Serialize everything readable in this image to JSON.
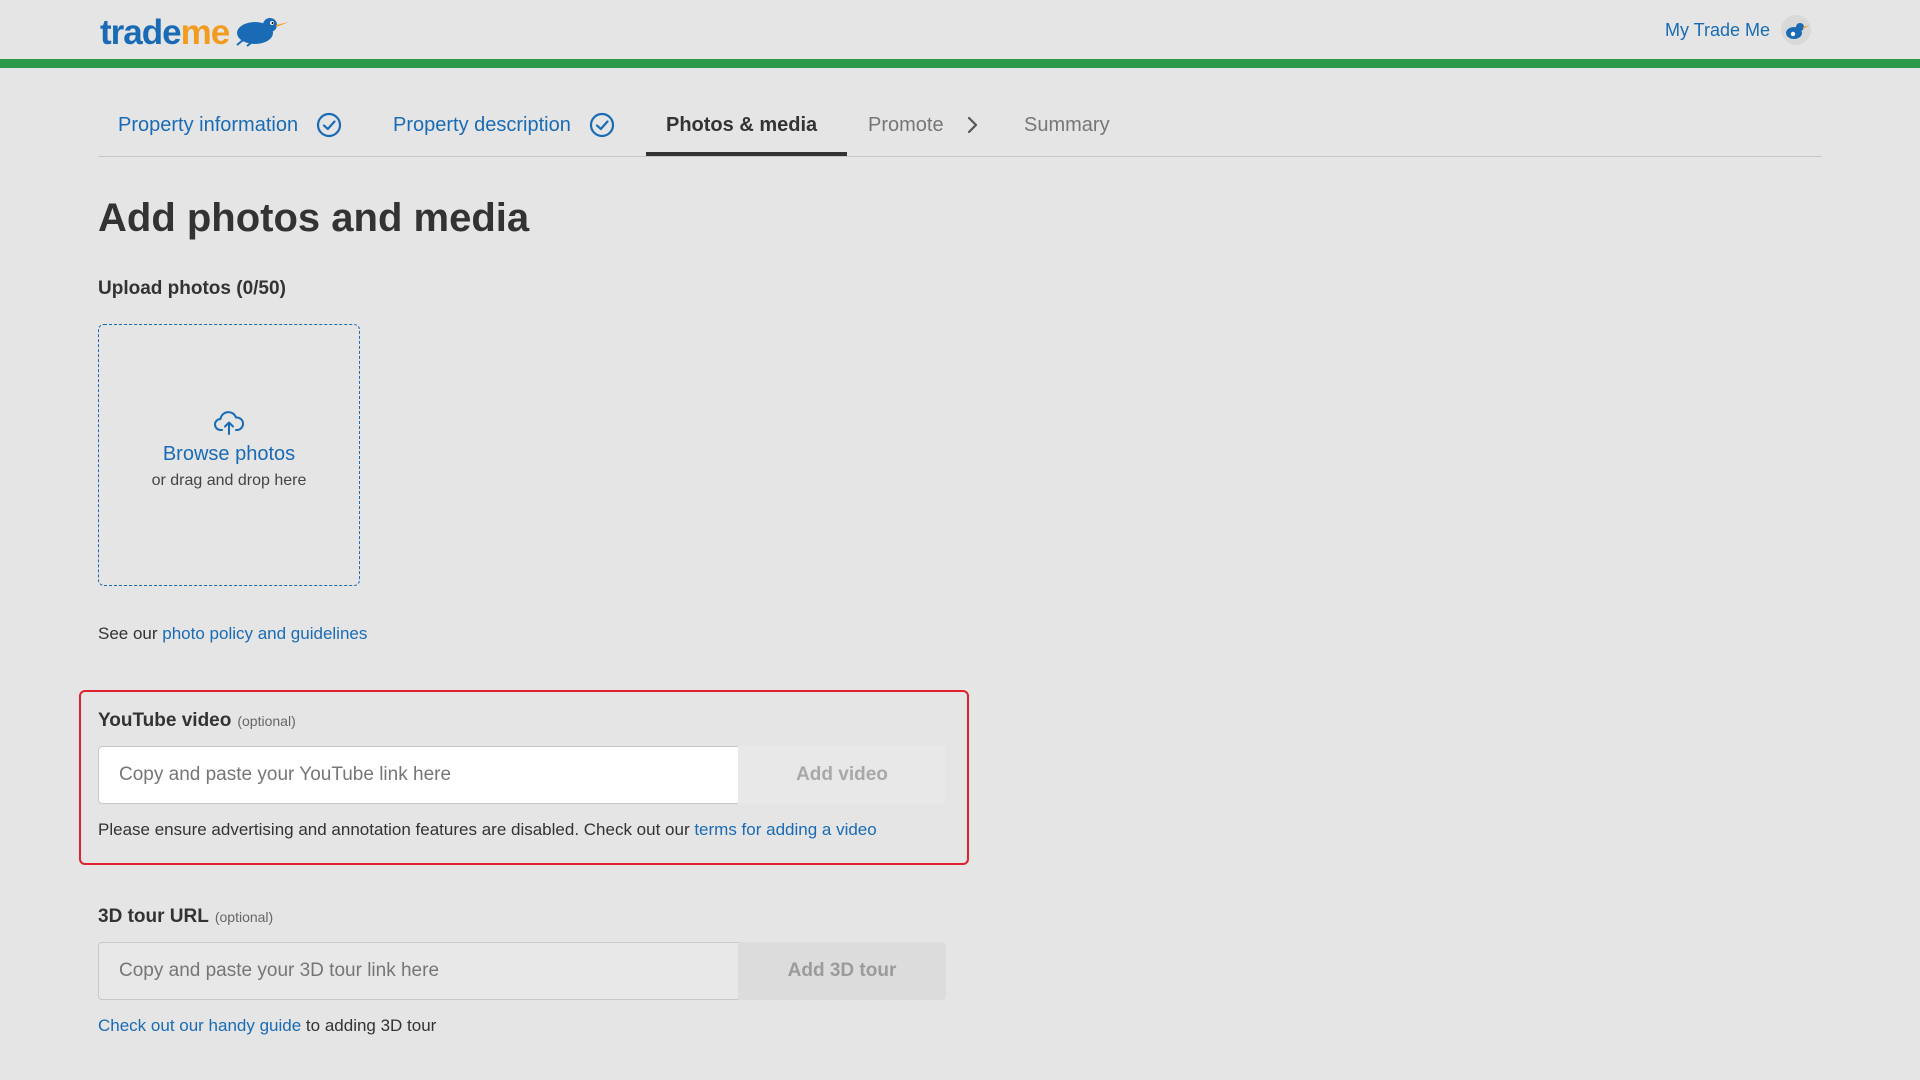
{
  "header": {
    "logo_part1": "trade",
    "logo_part2": "me",
    "my_trade_me": "My Trade Me"
  },
  "steps": [
    {
      "label": "Property information",
      "state": "done"
    },
    {
      "label": "Property description",
      "state": "done"
    },
    {
      "label": "Photos & media",
      "state": "active"
    },
    {
      "label": "Promote",
      "state": "future"
    },
    {
      "label": "Summary",
      "state": "future"
    }
  ],
  "page": {
    "title": "Add photos and media"
  },
  "upload": {
    "label": "Upload photos (0/50)",
    "browse": "Browse photos",
    "drag": "or drag and drop here",
    "policy_prefix": "See our ",
    "policy_link": "photo policy and guidelines"
  },
  "youtube": {
    "label": "YouTube video",
    "optional": "(optional)",
    "placeholder": "Copy and paste your YouTube link here",
    "button": "Add video",
    "help_prefix": "Please ensure advertising and annotation features are disabled. Check out our ",
    "help_link": "terms for adding a video"
  },
  "tour": {
    "label": "3D tour URL",
    "optional": "(optional)",
    "placeholder": "Copy and paste your 3D tour link here",
    "button": "Add 3D tour",
    "help_link": "Check out our handy guide",
    "help_suffix": " to adding 3D tour"
  },
  "colors": {
    "brand_blue": "#1a6bb5",
    "brand_orange": "#f29c1f",
    "header_green": "#2c9a4a",
    "highlight_red": "#e0222e"
  }
}
